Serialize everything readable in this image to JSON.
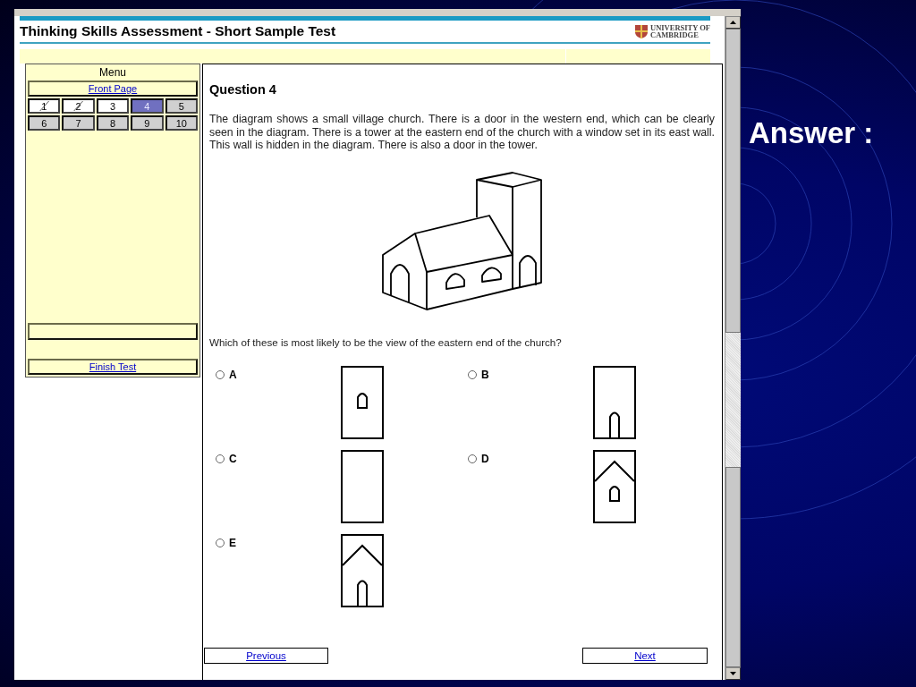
{
  "header": {
    "title": "Thinking Skills Assessment - Short Sample Test",
    "logo_lines": [
      "UNIVERSITY OF",
      "CAMBRIDGE"
    ]
  },
  "menu": {
    "title": "Menu",
    "front_page": "Front Page",
    "questions": [
      {
        "label": "1",
        "answered": true,
        "visited": true,
        "selected": false
      },
      {
        "label": "2",
        "answered": true,
        "visited": true,
        "selected": false
      },
      {
        "label": "3",
        "answered": false,
        "visited": true,
        "selected": false
      },
      {
        "label": "4",
        "answered": false,
        "visited": true,
        "selected": true
      },
      {
        "label": "5",
        "answered": false,
        "visited": false,
        "selected": false
      },
      {
        "label": "6",
        "answered": false,
        "visited": false,
        "selected": false
      },
      {
        "label": "7",
        "answered": false,
        "visited": false,
        "selected": false
      },
      {
        "label": "8",
        "answered": false,
        "visited": false,
        "selected": false
      },
      {
        "label": "9",
        "answered": false,
        "visited": false,
        "selected": false
      },
      {
        "label": "10",
        "answered": false,
        "visited": false,
        "selected": false
      }
    ],
    "finish": "Finish Test"
  },
  "question": {
    "heading": "Question 4",
    "text": "The diagram shows a small village church.  There is a door in the western end, which can be clearly seen in the diagram.  There is a tower at the eastern end of the church with a window set in its east wall.  This wall is hidden in the diagram.  There is also a door in the tower.",
    "prompt": "Which of these is most likely to be the view of the eastern end of the church?",
    "options": [
      {
        "letter": "A",
        "selected": false,
        "kind": "window"
      },
      {
        "letter": "B",
        "selected": false,
        "kind": "door"
      },
      {
        "letter": "C",
        "selected": false,
        "kind": "blank"
      },
      {
        "letter": "D",
        "selected": false,
        "kind": "gable-window"
      },
      {
        "letter": "E",
        "selected": false,
        "kind": "gable-door"
      }
    ]
  },
  "nav": {
    "previous": "Previous",
    "next": "Next"
  },
  "slide": {
    "title": "Answer :"
  }
}
